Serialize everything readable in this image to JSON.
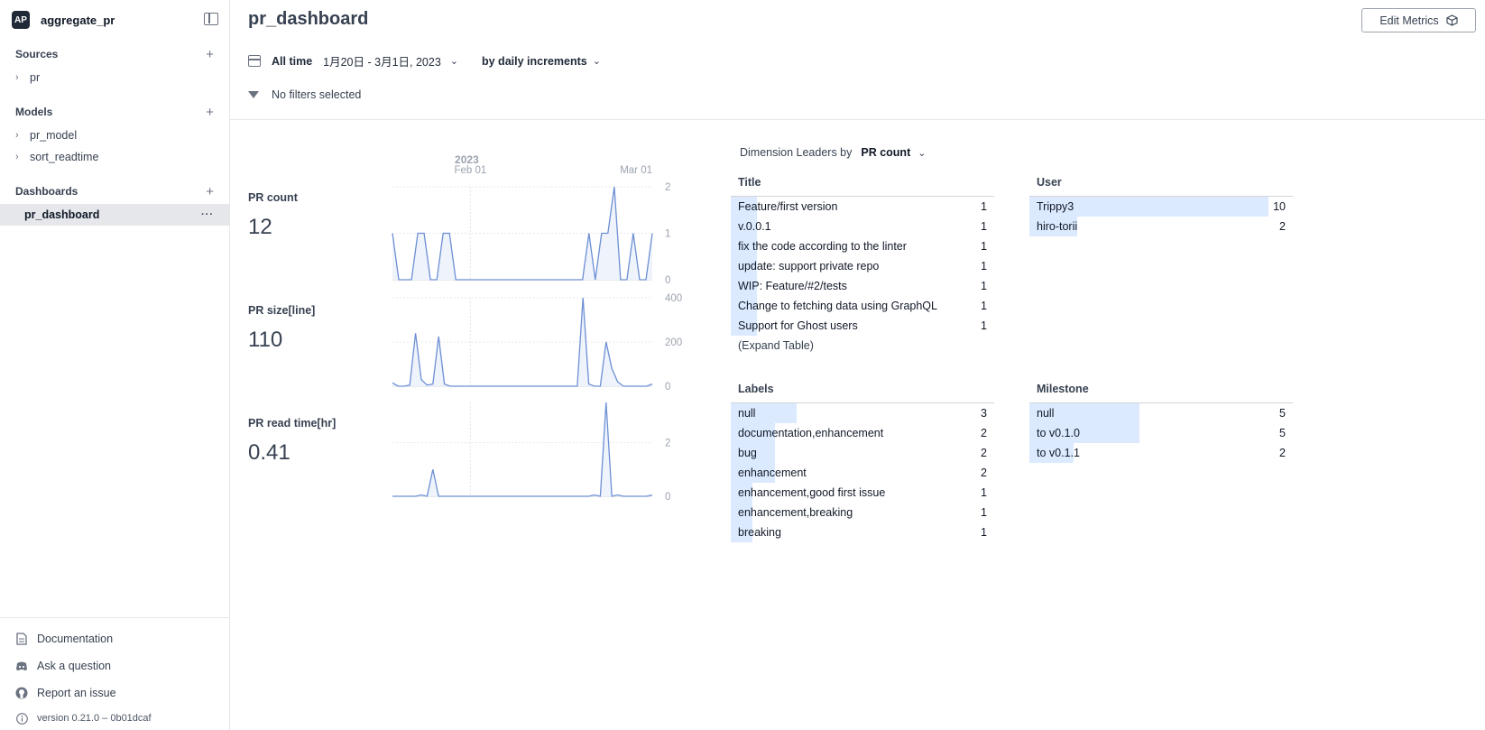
{
  "sidebar": {
    "avatar": "AP",
    "project": "aggregate_pr",
    "sections": [
      {
        "title": "Sources",
        "items": [
          "pr"
        ]
      },
      {
        "title": "Models",
        "items": [
          "pr_model",
          "sort_readtime"
        ]
      }
    ],
    "dashboards_title": "Dashboards",
    "dashboard_active": "pr_dashboard",
    "bottom": {
      "documentation": "Documentation",
      "ask": "Ask a question",
      "report": "Report an issue",
      "version": "version 0.21.0 – 0b01dcaf"
    }
  },
  "header": {
    "title": "pr_dashboard",
    "edit_label": "Edit Metrics"
  },
  "toolbar": {
    "range_label": "All time",
    "date_range": "1月20日 - 3月1日, 2023",
    "increment": "by daily increments",
    "filters": "No filters selected"
  },
  "metrics": {
    "year_label": "2023",
    "x_ticks": [
      "Feb 01",
      "Mar 01"
    ],
    "items": [
      {
        "name": "PR count",
        "value": "12"
      },
      {
        "name": "PR size[line]",
        "value": "110"
      },
      {
        "name": "PR read time[hr]",
        "value": "0.41"
      }
    ]
  },
  "chart_data": [
    {
      "type": "area",
      "title": "PR count",
      "x_range": [
        "2023-01-20",
        "2023-03-01"
      ],
      "ylim": [
        0,
        2
      ],
      "y_ticks": [
        0,
        1,
        2
      ],
      "values": [
        1,
        0,
        0,
        0,
        1,
        1,
        0,
        0,
        1,
        1,
        0,
        0,
        0,
        0,
        0,
        0,
        0,
        0,
        0,
        0,
        0,
        0,
        0,
        0,
        0,
        0,
        0,
        0,
        0,
        0,
        0,
        1,
        0,
        1,
        1,
        2,
        0,
        0,
        1,
        0,
        0,
        1
      ]
    },
    {
      "type": "area",
      "title": "PR size[line]",
      "x_range": [
        "2023-01-20",
        "2023-03-01"
      ],
      "ylim": [
        0,
        400
      ],
      "y_ticks": [
        0,
        200,
        400
      ],
      "values": [
        15,
        0,
        0,
        5,
        240,
        30,
        5,
        10,
        225,
        10,
        0,
        0,
        0,
        0,
        0,
        0,
        0,
        0,
        0,
        0,
        0,
        0,
        0,
        0,
        0,
        0,
        0,
        0,
        0,
        0,
        0,
        0,
        0,
        420,
        10,
        0,
        0,
        200,
        80,
        20,
        0,
        0,
        0,
        0,
        0,
        10
      ]
    },
    {
      "type": "area",
      "title": "PR read time[hr]",
      "x_range": [
        "2023-01-20",
        "2023-03-01"
      ],
      "ylim": [
        0,
        3.5
      ],
      "y_ticks": [
        0,
        2
      ],
      "values": [
        0,
        0,
        0,
        0,
        0,
        0.05,
        0,
        1.0,
        0,
        0,
        0,
        0,
        0,
        0,
        0,
        0,
        0,
        0,
        0,
        0,
        0,
        0,
        0,
        0,
        0,
        0,
        0,
        0,
        0,
        0,
        0,
        0,
        0,
        0,
        0,
        0.05,
        0,
        3.5,
        0,
        0.05,
        0,
        0,
        0,
        0,
        0,
        0.05
      ]
    }
  ],
  "leaders": {
    "label": "Dimension Leaders by",
    "measure": "PR count",
    "expand": "(Expand Table)",
    "tables": [
      {
        "title": "Title",
        "max": 10,
        "rows": [
          [
            "Feature/first version",
            1
          ],
          [
            "v.0.0.1",
            1
          ],
          [
            "fix the code according to the linter",
            1
          ],
          [
            "update: support private repo",
            1
          ],
          [
            "WIP: Feature/#2/tests",
            1
          ],
          [
            "Change to fetching data using GraphQL",
            1
          ],
          [
            "Support for Ghost users",
            1
          ]
        ]
      },
      {
        "title": "User",
        "max": 11,
        "rows": [
          [
            "Trippy3",
            10
          ],
          [
            "hiro-torii",
            2
          ]
        ]
      },
      {
        "title": "Labels",
        "max": 12,
        "rows": [
          [
            "null",
            3
          ],
          [
            "documentation,enhancement",
            2
          ],
          [
            "bug",
            2
          ],
          [
            "enhancement",
            2
          ],
          [
            "enhancement,good first issue",
            1
          ],
          [
            "enhancement,breaking",
            1
          ],
          [
            "breaking",
            1
          ]
        ]
      },
      {
        "title": "Milestone",
        "max": 12,
        "rows": [
          [
            "null",
            5
          ],
          [
            "to v0.1.0",
            5
          ],
          [
            "to v0.1.1",
            2
          ]
        ]
      }
    ]
  },
  "colors": {
    "line": "#6d8fd4",
    "fill": "#eef3fc",
    "bar": "#dbeafe"
  }
}
